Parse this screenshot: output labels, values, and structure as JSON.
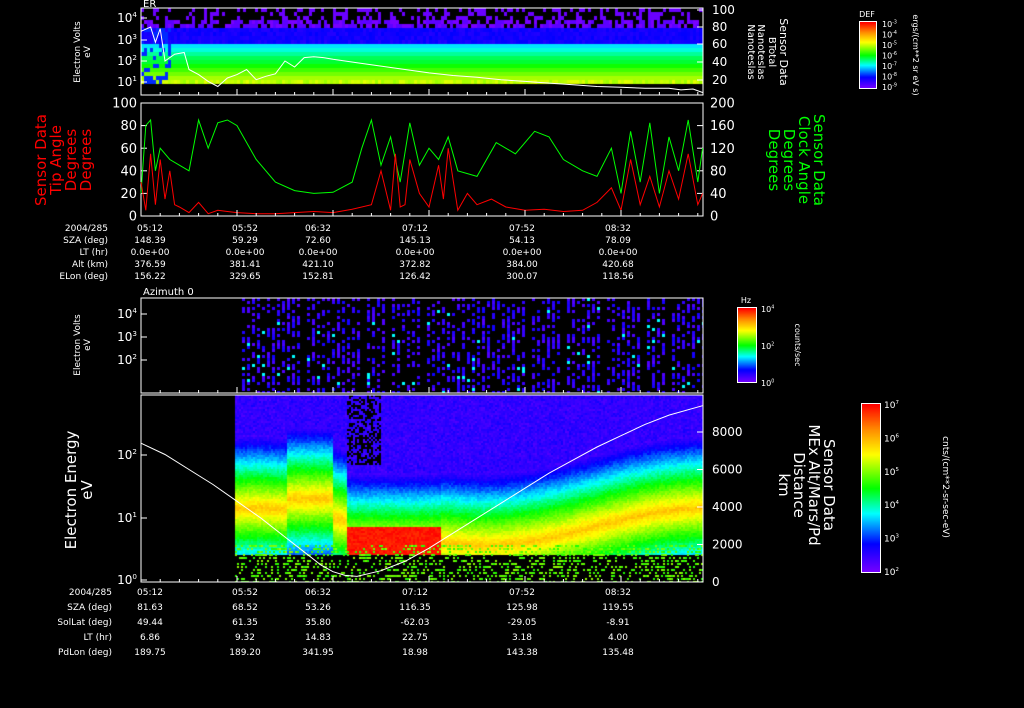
{
  "chart_data": [
    {
      "type": "heatmap",
      "id": "er",
      "title": "ER",
      "ylabel": [
        "Electron Volts",
        "eV"
      ],
      "yscale": "log",
      "ylim_exp": [
        0.2,
        4.3
      ],
      "yticks": [
        "10^4",
        "10^3",
        "10^2",
        "10^1"
      ],
      "y2label": [
        "Sensor Data",
        "BTotal",
        "Nanoteslas",
        "Nanoteslas"
      ],
      "y2lim": [
        0,
        100
      ],
      "y2ticks": [
        "100",
        "80",
        "60",
        "40",
        "20"
      ],
      "colorbar": {
        "title": "DEF",
        "label": "ergs/(cm**2 sr eV s)",
        "ticks": [
          "10^-3",
          "10^-4",
          "10^-5",
          "10^-6",
          "10^-7",
          "10^-8",
          "10^-9"
        ]
      },
      "line_btotal": {
        "minutes": [
          0,
          4,
          6,
          8,
          10,
          14,
          18,
          20,
          24,
          28,
          32,
          36,
          40,
          44,
          48,
          52,
          56,
          60,
          64,
          68,
          72,
          76,
          80,
          90,
          100,
          110,
          120,
          130,
          140,
          150,
          160,
          170,
          180,
          190,
          200,
          210,
          220,
          225,
          230,
          234
        ],
        "values": [
          75,
          80,
          62,
          78,
          40,
          48,
          50,
          30,
          24,
          16,
          10,
          20,
          24,
          30,
          18,
          22,
          25,
          40,
          33,
          44,
          45,
          44,
          42,
          38,
          34,
          30,
          26,
          23,
          21,
          18,
          16,
          14,
          12,
          10,
          9,
          8,
          8,
          6,
          7,
          3
        ]
      }
    },
    {
      "type": "line",
      "id": "angles",
      "ylabel": [
        "Sensor Data",
        "Tip Angle",
        "Degrees",
        "Degrees"
      ],
      "ylim": [
        0,
        100
      ],
      "yticks": [
        "100",
        "80",
        "60",
        "40",
        "20",
        "0"
      ],
      "y2label": [
        "Sensor Data",
        "Clock Angle",
        "Degrees",
        "Degrees"
      ],
      "y2lim": [
        0,
        200
      ],
      "y2ticks": [
        "200",
        "160",
        "120",
        "80",
        "40",
        "0"
      ],
      "series": [
        {
          "name": "Tip Angle",
          "color": "#ff0000",
          "minutes": [
            0,
            2,
            4,
            6,
            8,
            10,
            12,
            14,
            16,
            20,
            24,
            28,
            32,
            36,
            40,
            48,
            56,
            64,
            72,
            80,
            88,
            96,
            100,
            104,
            106,
            108,
            110,
            112,
            116,
            120,
            124,
            126,
            128,
            132,
            136,
            140,
            146,
            152,
            160,
            168,
            176,
            184,
            190,
            196,
            200,
            204,
            208,
            212,
            216,
            220,
            224,
            228,
            232,
            234
          ],
          "values": [
            30,
            5,
            55,
            10,
            50,
            15,
            40,
            10,
            8,
            3,
            12,
            2,
            5,
            4,
            3,
            2,
            2,
            3,
            4,
            3,
            6,
            10,
            40,
            5,
            55,
            8,
            10,
            50,
            20,
            8,
            45,
            15,
            60,
            5,
            20,
            10,
            15,
            8,
            5,
            6,
            4,
            5,
            12,
            25,
            5,
            50,
            10,
            35,
            8,
            40,
            15,
            55,
            10,
            20
          ]
        },
        {
          "name": "Clock Angle",
          "color": "#00ff00",
          "minutes": [
            0,
            2,
            4,
            6,
            8,
            12,
            16,
            20,
            24,
            28,
            32,
            36,
            40,
            48,
            56,
            64,
            72,
            80,
            88,
            92,
            96,
            100,
            104,
            108,
            112,
            116,
            120,
            124,
            128,
            132,
            140,
            148,
            156,
            164,
            170,
            176,
            184,
            190,
            196,
            200,
            204,
            208,
            212,
            216,
            220,
            224,
            228,
            232,
            234
          ],
          "values": [
            40,
            160,
            170,
            80,
            120,
            100,
            90,
            80,
            170,
            120,
            165,
            170,
            160,
            100,
            60,
            45,
            40,
            42,
            60,
            120,
            170,
            90,
            140,
            60,
            165,
            90,
            120,
            100,
            140,
            80,
            70,
            130,
            110,
            150,
            140,
            100,
            80,
            70,
            120,
            40,
            150,
            60,
            165,
            40,
            140,
            80,
            170,
            60,
            120
          ]
        }
      ]
    },
    {
      "type": "heatmap",
      "id": "azimuth",
      "title": "Azimuth 0",
      "ylabel": [
        "Electron Volts",
        "eV"
      ],
      "yticks": [
        "10^4",
        "10^3",
        "10^2"
      ],
      "colorbar": {
        "title": "Hz",
        "label": "counts/sec",
        "ticks": [
          "10^4",
          "10^2",
          "10^0"
        ]
      }
    },
    {
      "type": "heatmap",
      "id": "electron_energy",
      "ylabel": [
        "Electron Energy",
        "eV"
      ],
      "yticks": [
        "10^2",
        "10^1",
        "10^0"
      ],
      "y2label": [
        "Sensor Data",
        "MEx Alt/Mars/Pd",
        "Distance",
        "km"
      ],
      "y2lim": [
        0,
        9500
      ],
      "y2ticks": [
        "8000",
        "6000",
        "4000",
        "2000",
        "0"
      ],
      "colorbar": {
        "label": "cnts/(cm**2-sr-sec-eV)",
        "ticks": [
          "10^7",
          "10^6",
          "10^5",
          "10^4",
          "10^3",
          "10^2"
        ]
      },
      "line_altitude": {
        "minutes": [
          0,
          10,
          20,
          30,
          40,
          50,
          60,
          70,
          75,
          80,
          85,
          90,
          100,
          110,
          120,
          130,
          140,
          150,
          160,
          170,
          180,
          190,
          200,
          210,
          220,
          234
        ],
        "values": [
          7400,
          6800,
          6000,
          5200,
          4300,
          3400,
          2400,
          1400,
          900,
          550,
          350,
          300,
          600,
          1100,
          1800,
          2600,
          3400,
          4200,
          5000,
          5800,
          6500,
          7200,
          7800,
          8400,
          8900,
          9400
        ]
      }
    }
  ],
  "table1": {
    "rows": [
      {
        "label": "2004/285",
        "values": [
          "05:12",
          "05:52",
          "06:32",
          "07:12",
          "07:52",
          "08:32"
        ]
      },
      {
        "label": "SZA (deg)",
        "values": [
          "148.39",
          "59.29",
          "72.60",
          "145.13",
          "54.13",
          "78.09"
        ]
      },
      {
        "label": "LT (hr)",
        "values": [
          "0.0e+00",
          "0.0e+00",
          "0.0e+00",
          "0.0e+00",
          "0.0e+00",
          "0.0e+00"
        ]
      },
      {
        "label": "Alt (km)",
        "values": [
          "376.59",
          "381.41",
          "421.10",
          "372.82",
          "384.00",
          "420.68"
        ]
      },
      {
        "label": "ELon (deg)",
        "values": [
          "156.22",
          "329.65",
          "152.81",
          "126.42",
          "300.07",
          "118.56"
        ]
      }
    ]
  },
  "table2": {
    "rows": [
      {
        "label": "2004/285",
        "values": [
          "05:12",
          "05:52",
          "06:32",
          "07:12",
          "07:52",
          "08:32"
        ]
      },
      {
        "label": "SZA (deg)",
        "values": [
          "81.63",
          "68.52",
          "53.26",
          "116.35",
          "125.98",
          "119.55"
        ]
      },
      {
        "label": "SolLat (deg)",
        "values": [
          "49.44",
          "61.35",
          "35.80",
          "-62.03",
          "-29.05",
          "-8.91"
        ]
      },
      {
        "label": "LT (hr)",
        "values": [
          "6.86",
          "9.32",
          "14.83",
          "22.75",
          "3.18",
          "4.00"
        ]
      },
      {
        "label": "PdLon (deg)",
        "values": [
          "189.75",
          "189.20",
          "341.95",
          "18.98",
          "143.38",
          "135.48"
        ]
      }
    ]
  }
}
